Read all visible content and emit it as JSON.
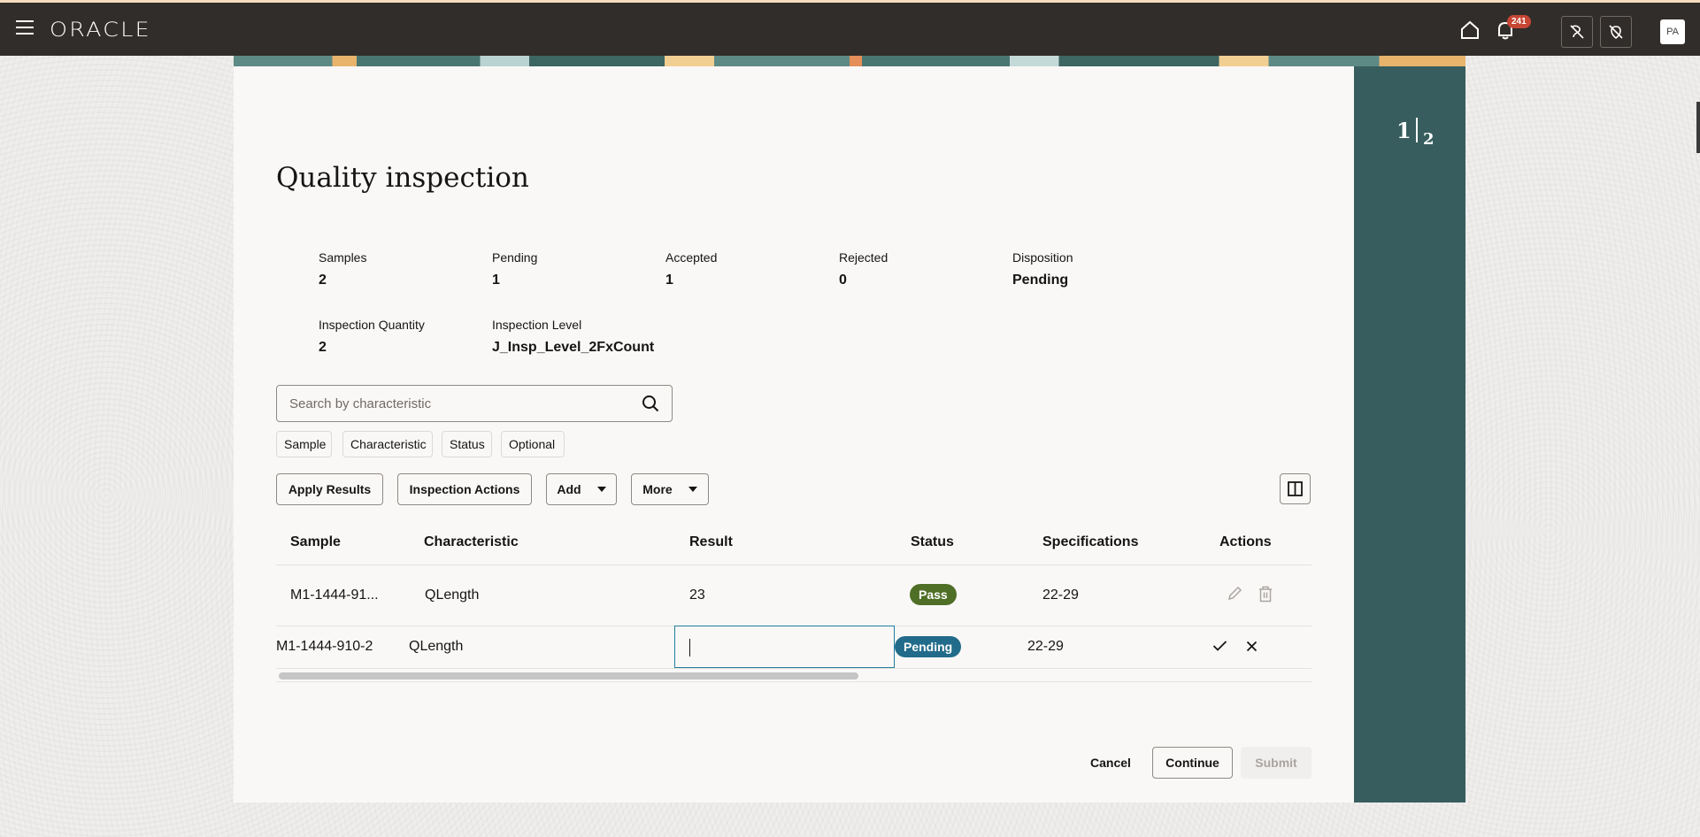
{
  "header": {
    "brand": "ORACLE",
    "notification_count": "241",
    "user_initials": "PA",
    "icons": [
      "menu-icon",
      "home-icon",
      "bell-icon",
      "accessibility-off-icon",
      "pin-off-icon"
    ]
  },
  "train": {
    "current_step": "1",
    "total_steps": "2"
  },
  "page": {
    "title": "Quality inspection"
  },
  "stats": [
    {
      "label": "Samples",
      "value": "2"
    },
    {
      "label": "Pending",
      "value": "1"
    },
    {
      "label": "Accepted",
      "value": "1"
    },
    {
      "label": "Rejected",
      "value": "0"
    },
    {
      "label": "Disposition",
      "value": "Pending"
    },
    {
      "label": "Inspection Quantity",
      "value": "2"
    },
    {
      "label": "Inspection Level",
      "value": "J_Insp_Level_2FxCount"
    }
  ],
  "search": {
    "placeholder": "Search by characteristic",
    "value": ""
  },
  "filter_chips": [
    "Sample",
    "Characteristic",
    "Status",
    "Optional"
  ],
  "toolbar": {
    "apply_results": "Apply Results",
    "inspection_actions": "Inspection Actions",
    "add": "Add",
    "more": "More"
  },
  "table": {
    "columns": [
      "Sample",
      "Characteristic",
      "Result",
      "Status",
      "Specifications",
      "Actions"
    ],
    "rows": [
      {
        "sample": "M1-1444-91...",
        "characteristic": "QLength",
        "result": "23",
        "status": "Pass",
        "specifications": "22-29",
        "mode": "view"
      },
      {
        "sample": "M1-1444-910-2",
        "characteristic": "QLength",
        "result": "",
        "status": "Pending",
        "specifications": "22-29",
        "mode": "edit"
      }
    ],
    "status_colors": {
      "Pass": "#4f6f26",
      "Pending": "#226b8a"
    }
  },
  "footer": {
    "cancel": "Cancel",
    "continue": "Continue",
    "submit": "Submit"
  }
}
